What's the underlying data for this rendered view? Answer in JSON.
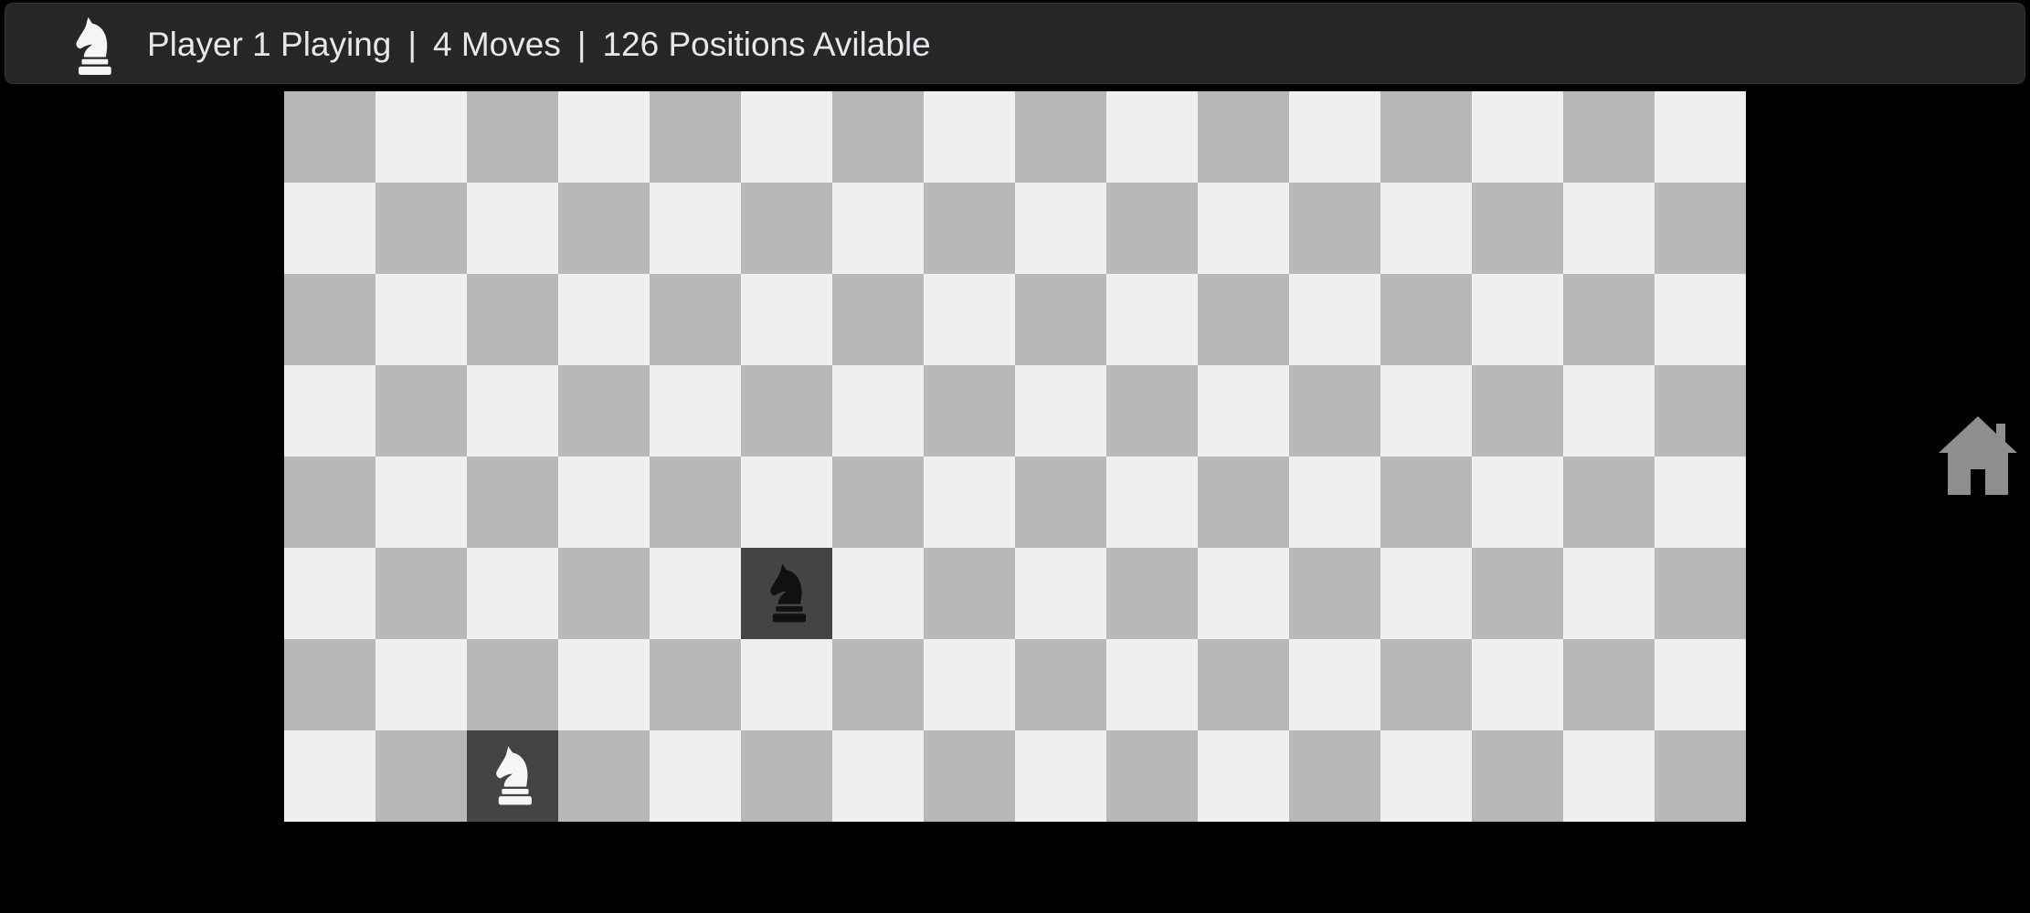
{
  "status": {
    "player": "Player 1 Playing",
    "separator": "|",
    "moves": "4 Moves",
    "positions": "126 Positions Avilable",
    "icon": "white-knight-icon"
  },
  "board": {
    "columns": 16,
    "rows": 8,
    "colors": {
      "light": "#eeeff1",
      "dark": "#b8b8b9",
      "occupied": "#434445"
    },
    "pieces": [
      {
        "name": "black-knight",
        "row": 5,
        "col": 5,
        "color": "#111111"
      },
      {
        "name": "white-knight",
        "row": 7,
        "col": 2,
        "color": "#f4f7f6"
      }
    ]
  },
  "home": {
    "icon": "home-icon",
    "color": "#8e8e8f"
  }
}
